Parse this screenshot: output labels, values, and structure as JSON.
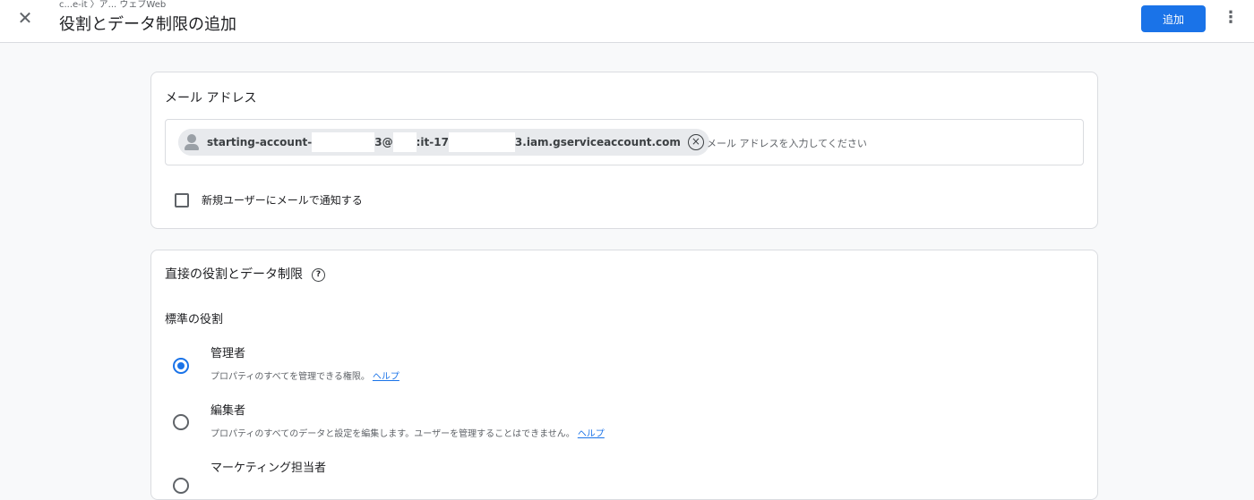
{
  "header": {
    "breadcrumb": "c...e-it 〉ア... ウェブWeb",
    "title": "役割とデータ制限の追加",
    "add_label": "追加",
    "more_icon": "more-vert-icon",
    "close_icon": "close-icon"
  },
  "email_card": {
    "title": "メール アドレス",
    "chip": {
      "part1": "starting-account-",
      "part2": "3@",
      "part3": ":it-17",
      "part4": "3.iam.gserviceaccount.com"
    },
    "placeholder": "メール アドレスを入力してください",
    "notify_label": "新規ユーザーにメールで通知する",
    "notify_checked": false
  },
  "roles_card": {
    "title": "直接の役割とデータ制限",
    "help_icon": "help-icon",
    "section_label": "標準の役割",
    "roles": [
      {
        "name": "管理者",
        "description": "プロパティのすべてを管理できる権限。",
        "help_link": "ヘルプ",
        "selected": true
      },
      {
        "name": "編集者",
        "description": "プロパティのすべてのデータと設定を編集します。ユーザーを管理することはできません。",
        "help_link": "ヘルプ",
        "selected": false
      },
      {
        "name": "マーケティング担当者",
        "description": "",
        "help_link": "",
        "selected": false
      }
    ]
  },
  "colors": {
    "accent": "#1a73e8",
    "background": "#f8f9fa",
    "card_border": "#dadce0"
  }
}
